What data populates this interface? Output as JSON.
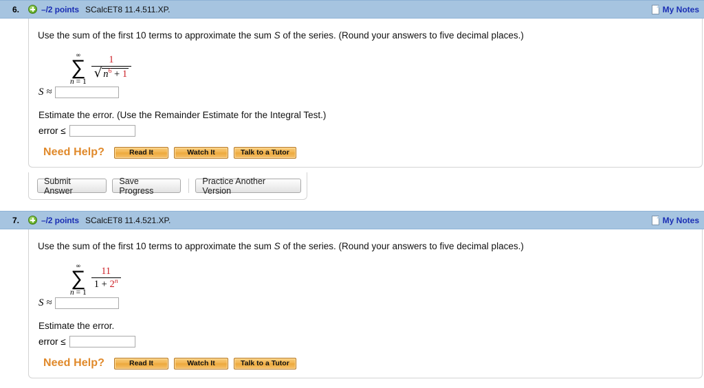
{
  "questions": [
    {
      "number": "6.",
      "points": "–/2 points",
      "code": "SCalcET8 11.4.511.XP.",
      "notes_label": "My Notes",
      "plus_icon": "plus-circle-icon",
      "notes_icon": "note-page-icon",
      "prompt_before": "Use the sum of the first 10 terms to approximate the sum ",
      "prompt_var": "S",
      "prompt_after": " of the series. (Round your answers to five decimal places.)",
      "math": {
        "sigma_top": "∞",
        "sigma_char": "∑",
        "sigma_bottom_var": "n",
        "sigma_bottom_rest": " = 1",
        "numerator": "1",
        "denominator_kind": "radical",
        "radical_sign": "√",
        "radical_base": "n",
        "radical_exponent": "6",
        "radical_tail_op": " + ",
        "radical_tail_num": "1"
      },
      "answer_label": "S ≈",
      "answer_value": "",
      "error_prompt": "Estimate the error. (Use the Remainder Estimate for the Integral Test.)",
      "error_label": "error ≤",
      "error_value": "",
      "need_help_label": "Need Help?",
      "help_buttons": [
        "Read It",
        "Watch It",
        "Talk to a Tutor"
      ],
      "has_submit_bar": true,
      "submit_buttons": [
        "Submit Answer",
        "Save Progress"
      ],
      "practice_button": "Practice Another Version"
    },
    {
      "number": "7.",
      "points": "–/2 points",
      "code": "SCalcET8 11.4.521.XP.",
      "notes_label": "My Notes",
      "plus_icon": "plus-circle-icon",
      "notes_icon": "note-page-icon",
      "prompt_before": "Use the sum of the first 10 terms to approximate the sum ",
      "prompt_var": "S",
      "prompt_after": " of the series. (Round your answers to five decimal places.)",
      "math": {
        "sigma_top": "∞",
        "sigma_char": "∑",
        "sigma_bottom_var": "n",
        "sigma_bottom_rest": " = 1",
        "numerator": "11",
        "denominator_kind": "plain",
        "den_lead": "1 + ",
        "den_base": "2",
        "den_exponent": "n"
      },
      "answer_label": "S ≈",
      "answer_value": "",
      "error_prompt": "Estimate the error.",
      "error_label": "error ≤",
      "error_value": "",
      "need_help_label": "Need Help?",
      "help_buttons": [
        "Read It",
        "Watch It",
        "Talk to a Tutor"
      ],
      "has_submit_bar": false
    }
  ],
  "colors": {
    "header_blue": "#a6c4e0",
    "link_blue": "#1b2fb4",
    "math_red": "#cc2127",
    "help_orange": "#e0892a"
  }
}
